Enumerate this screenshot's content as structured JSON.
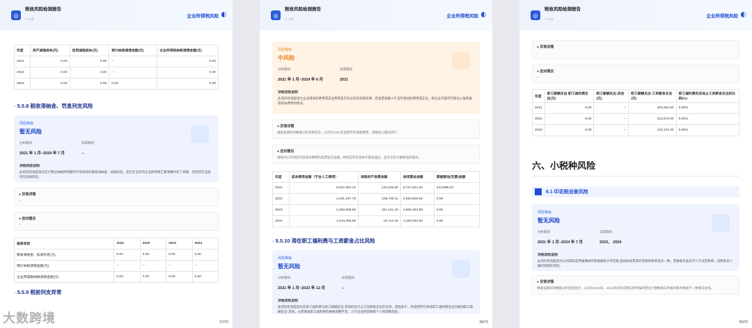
{
  "header": {
    "title": "税收风险检测报告",
    "sub": "***公司",
    "tag": "企业所得税风险"
  },
  "p1": {
    "page": "57/70",
    "table1": {
      "head": [
        "年度",
        "资产减值损失(元)",
        "信用减值损失(元)",
        "预计纳税调增金额(元)",
        "企业所得税纳税调增金额(元)"
      ],
      "rows": [
        [
          "2021",
          "0.00",
          "0.00",
          "--",
          "0.00"
        ],
        [
          "2022",
          "0.00",
          "0.00",
          "--",
          "0.00"
        ],
        [
          "2023",
          "0.00",
          "0.00",
          "0.00",
          "0.00"
        ]
      ]
    },
    "sec": "5.5.8 税收滞纳金、罚息列支风险",
    "card": {
      "label": "风险等级",
      "level": "暂无风险",
      "k1": "分析期间",
      "v1": "2021 年 1 月~2024 年 7 月",
      "k2": "异常期间",
      "v2": "--",
      "dt": "涉税风险说明",
      "dd": "此风险检测是指为在计算应纳税所得额时不得扣除的税收滞纳金、加收利息，是否在当年的企业所得税汇算清缴时作了调增，否则存在违规列支扣除风险。"
    },
    "b1": {
      "t": "异常详情",
      "c": "--"
    },
    "b2": {
      "t": "应对建议",
      "c": "--"
    },
    "table2": {
      "head": [
        "报表项目",
        "2021",
        "2022",
        "2023",
        "2024"
      ],
      "rows": [
        [
          "税收滞纳金、加收利息(元)",
          "0.00",
          "0.00",
          "0.00",
          "0.00"
        ],
        [
          "预计纳税调增金额(元)",
          "--",
          "--",
          "--",
          "--"
        ],
        [
          "企业所得税纳税调增金额(元)",
          "0.00",
          "0.00",
          "0.00",
          "0.00"
        ]
      ]
    },
    "sec2": "5.5.9 税前列支异常",
    "wm": "大数跨境"
  },
  "p2": {
    "page": "58/70",
    "card": {
      "label": "风险等级",
      "level": "中风险",
      "k1": "分析期间",
      "v1": "2021 年 1 月~2024 年 6 月",
      "k2": "异常期间",
      "v2": "2021",
      "dt": "涉税风险说明",
      "dd": "此风险检测是指为企业增加的费用或支出费用是否有业务的支撑支撑，若发票金额小于当年增加的费用或支出，则企业可能存在暂估入账或虚增成本费用的情况。"
    },
    "b1": {
      "t": "异常详情",
      "c": "根据该期间的数据分析结果显示，公司在2021年发票存在报销费用，或暂估入账的资产。"
    },
    "b2": {
      "t": "应对建议",
      "c": "请核对公司风险年度成本费用的发票是否准确，特别是存在成本计量处理过，是否涉及大额暂估的情况。"
    },
    "table": {
      "head": [
        "年度",
        "成本费用总额（不含人工费用）",
        "采购资产发票金额",
        "进项票总金额",
        "票据暂估(无票)金额"
      ],
      "rows": [
        [
          "2021",
          "6,037,994.13",
          "134,536.80",
          "5,727,941.40",
          "444,699.53"
        ],
        [
          "2022",
          "2,341,197.78",
          "106,728.11",
          "2,554,556.92",
          "0.00"
        ],
        [
          "2023",
          "2,392,566.60",
          "311,141.18",
          "2,806,484.56",
          "0.00"
        ],
        [
          "2024",
          "1,044,086.96",
          "19,714.46",
          "1,150,091.60",
          "0.00"
        ]
      ]
    },
    "sec": "5.5.10 滞在职工福利费与工资薪金占比风险",
    "card2": {
      "label": "风险等级",
      "level": "暂无风险",
      "k1": "分析期间",
      "v1": "2021 年 1 月~2023 年 12 月",
      "k2": "异常期间",
      "v2": "--",
      "dt": "涉税风险说明",
      "dd": "此风险检测是指为在职工福利费与职工薪酬支出-其他的合计占工资薪金支出的比例，若超高于，则说明存在将非职工福利费支出归集到职工薪酬支出-其他，从而增加职工福利费的纳税调整不足，少计企业所得税和个人所得税风险。"
    }
  },
  "p3": {
    "page": "59/70",
    "b1": {
      "t": "异常详情",
      "c": "--"
    },
    "b2": {
      "t": "应对建议",
      "c": "--"
    },
    "table": {
      "head": [
        "年度",
        "职工薪酬支出-职工福利费支出(元)",
        "职工薪酬支出-其他(元)",
        "职工薪酬支出-工资薪金支出(元)",
        "职工福利费及其他占工资薪金支出的比例(%)"
      ],
      "rows": [
        [
          "2021",
          "0.00",
          "--",
          "200,484.00",
          "0.00%"
        ],
        [
          "2022",
          "0.00",
          "--",
          "122,873.00",
          "0.00%"
        ],
        [
          "2023",
          "0.00",
          "--",
          "123,121.00",
          "0.00%"
        ]
      ]
    },
    "h6": "六、小税种风险",
    "h61": "6.1 印花税自查风险",
    "card": {
      "label": "风险等级",
      "level": "暂无风险",
      "k1": "分析期间",
      "v1": "2021 年 1 月~2024 年 7 月",
      "k2": "异常期间",
      "v2": "2023、 2024",
      "dt": "涉税风险说明",
      "dd": "此风险检测是指为公司每年度申报缴纳的营收额统计印花税,是按取发票及印花税的税率是否一致，若数据有差异不少于法定税率，说明有多少缴印花税的风险。"
    },
    "b3": {
      "t": "异常详情",
      "c": "根据该期间的数据分析结果显示，公司在2023年、2024年的印花税实际申报的营业计缴数据与申报的税务数据不一致情况发现。"
    }
  }
}
